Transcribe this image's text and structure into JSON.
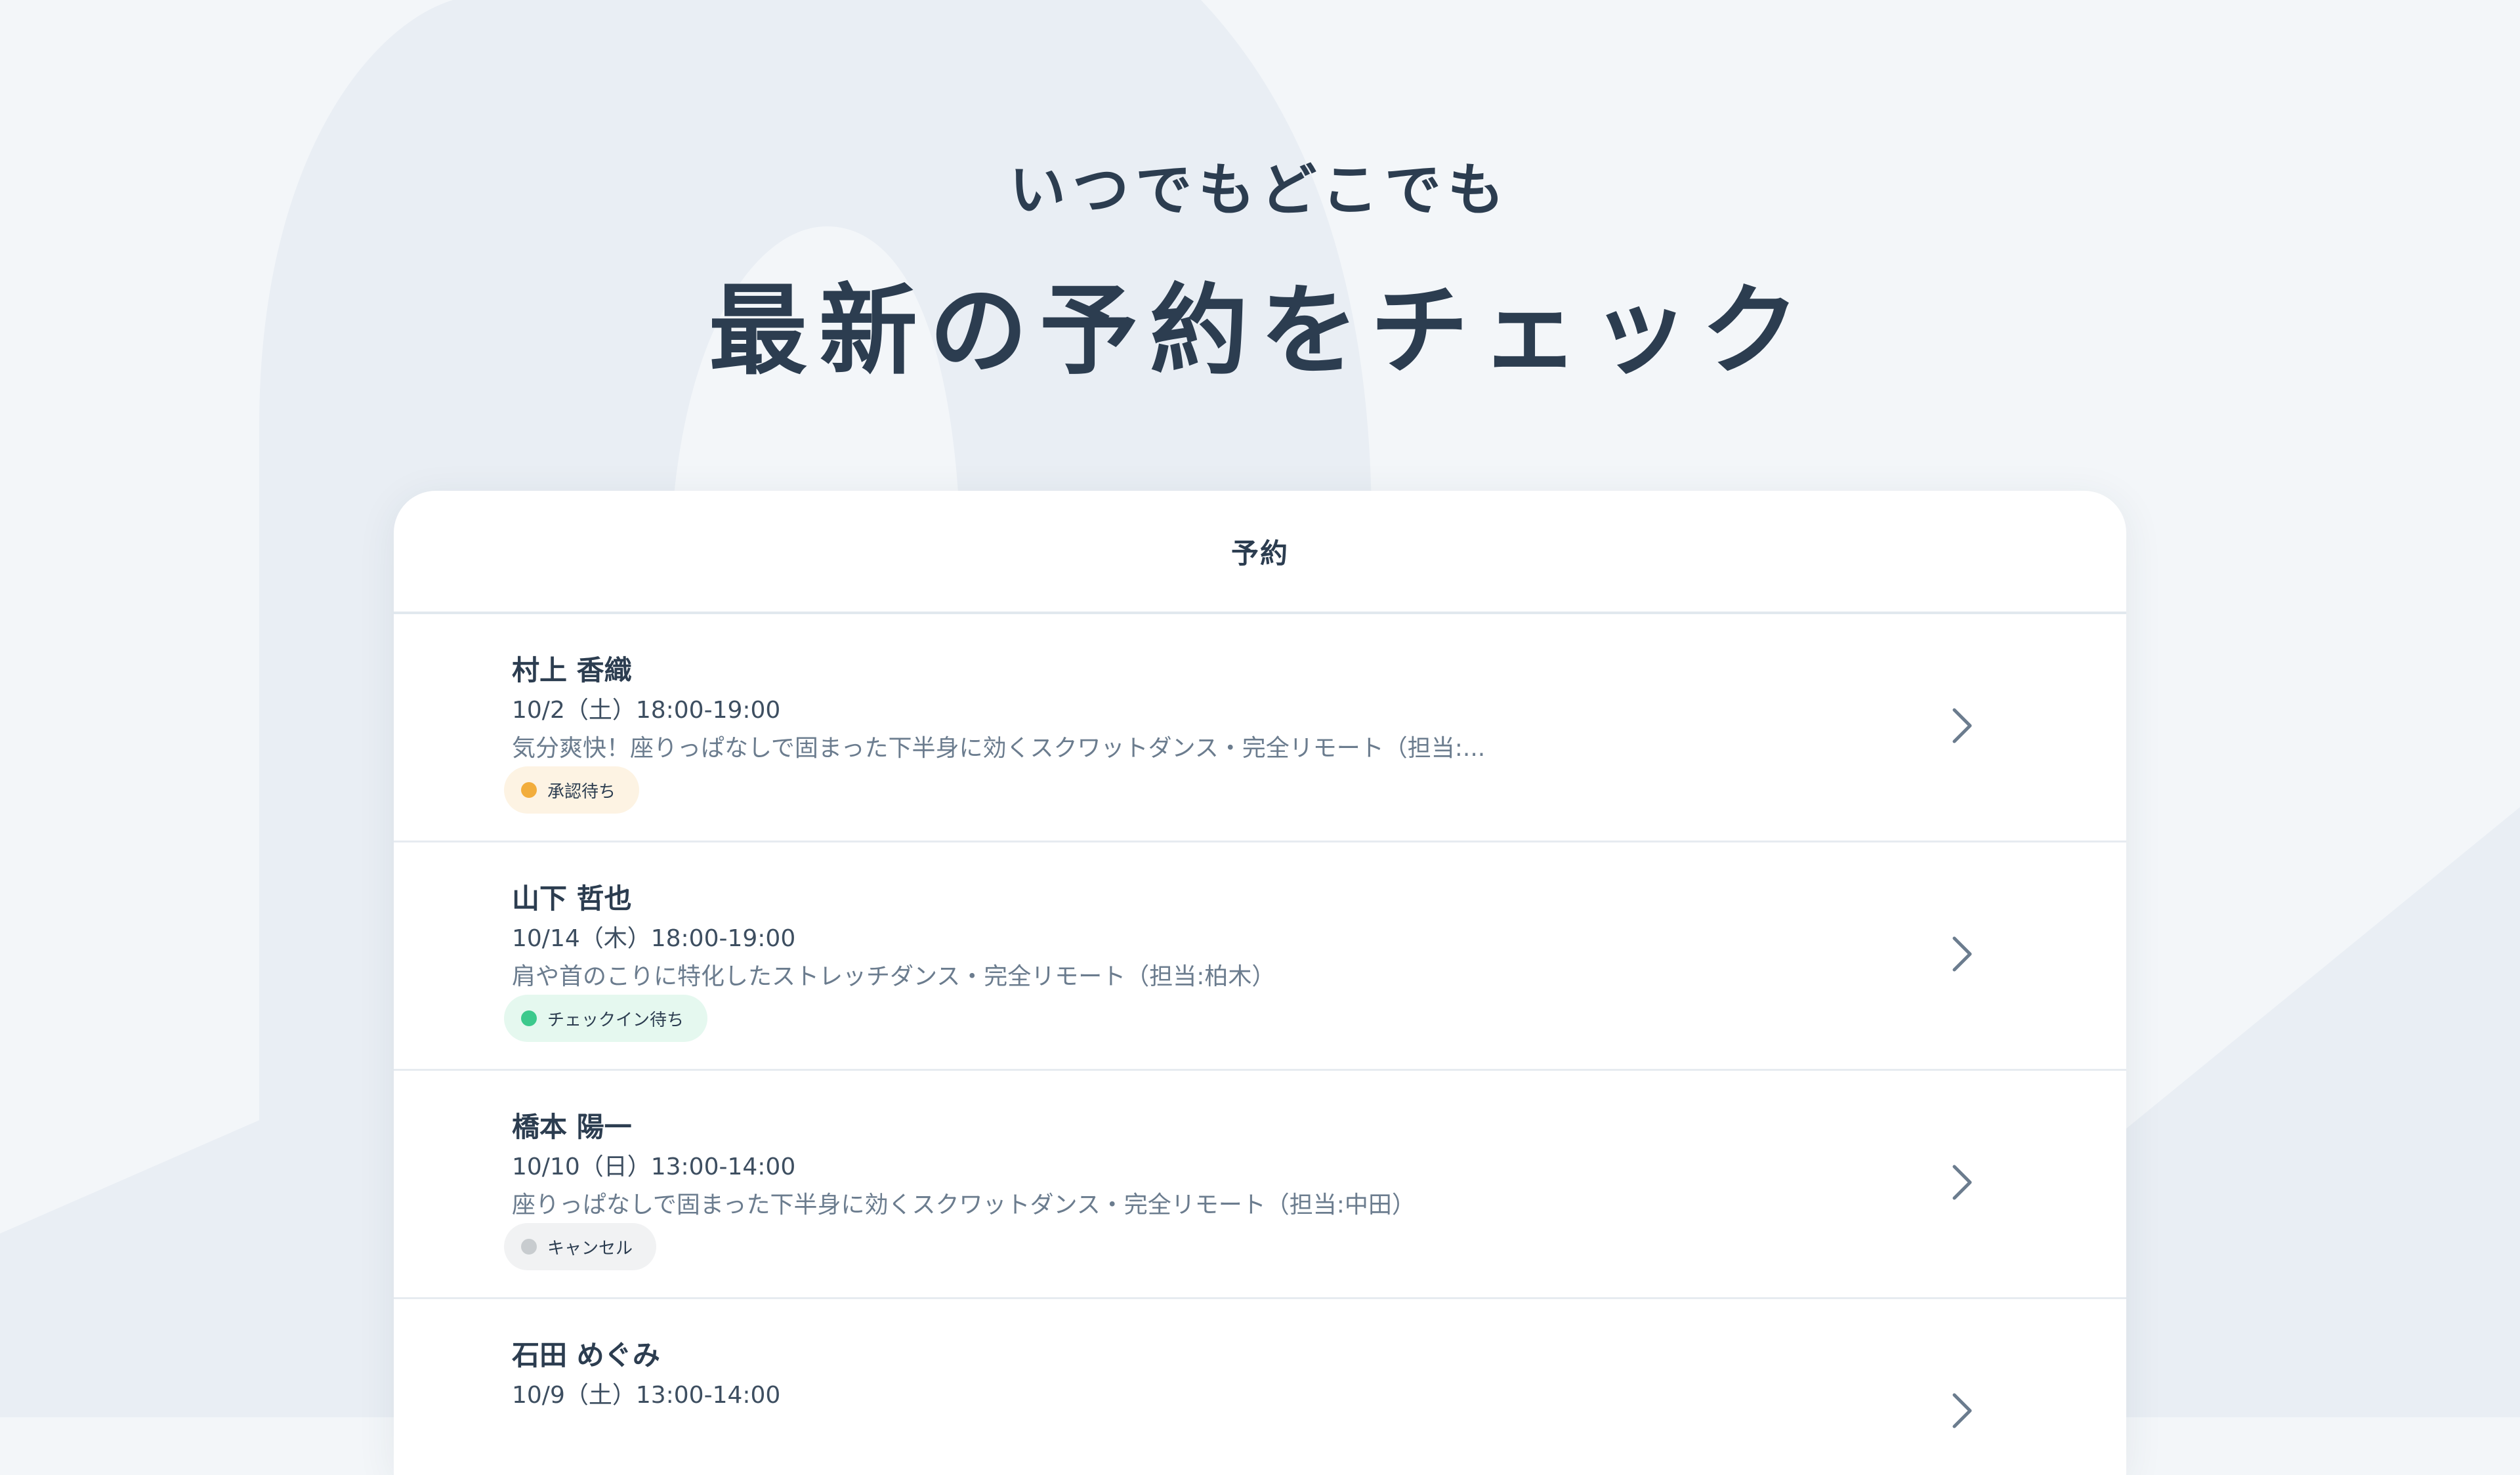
{
  "hero": {
    "subtitle": "いつでもどこでも",
    "title": "最新の予約をチェック"
  },
  "card": {
    "title": "予約"
  },
  "reservations": [
    {
      "name": "村上 香織",
      "datetime": "10/2（土）18:00-19:00",
      "description": "気分爽快！座りっぱなしで固まった下半身に効くスクワットダンス・完全リモート（担当:...",
      "status": "承認待ち",
      "status_color": "#f2ad3c",
      "status_bg": "#fdf3e3"
    },
    {
      "name": "山下 哲也",
      "datetime": "10/14（木）18:00-19:00",
      "description": "肩や首のこりに特化したストレッチダンス・完全リモート（担当:柏木）",
      "status": "チェックイン待ち",
      "status_color": "#3cc98c",
      "status_bg": "#e5f8ef"
    },
    {
      "name": "橋本 陽一",
      "datetime": "10/10（日）13:00-14:00",
      "description": "座りっぱなしで固まった下半身に効くスクワットダンス・完全リモート（担当:中田）",
      "status": "キャンセル",
      "status_color": "#c8cccf",
      "status_bg": "#f1f2f3"
    },
    {
      "name": "石田 めぐみ",
      "datetime": "10/9（土）13:00-14:00",
      "description": "",
      "status": "",
      "status_color": "",
      "status_bg": ""
    }
  ],
  "icons": {
    "row_action": "chevron-right-icon"
  },
  "colors": {
    "page_bg": "#f3f6f9",
    "text_primary": "#2c3d50",
    "text_secondary": "#6b7c8e"
  }
}
